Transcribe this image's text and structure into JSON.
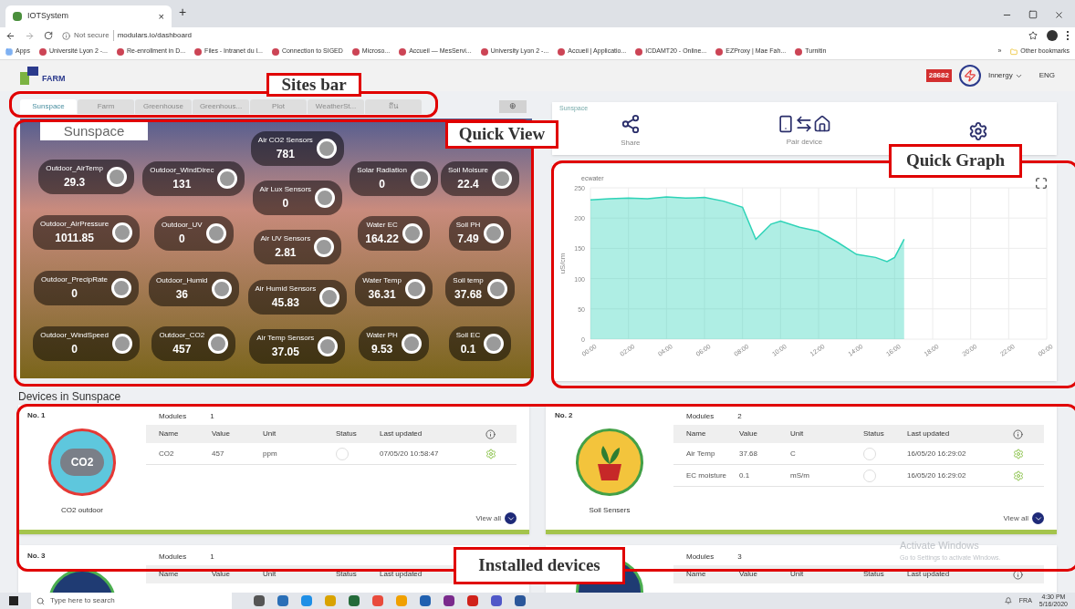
{
  "browser": {
    "tab_title": "IOTSystem",
    "tab_close": "×",
    "new_tab": "+",
    "security": "Not secure",
    "url": "modulars.io/dashboard",
    "bookmarks": [
      {
        "label": "Apps"
      },
      {
        "label": "Université Lyon 2 -..."
      },
      {
        "label": "Re-enrollment in D..."
      },
      {
        "label": "Files - Intranet du l..."
      },
      {
        "label": "Connection to SIGED"
      },
      {
        "label": "Microso..."
      },
      {
        "label": "Accueil — MesServi..."
      },
      {
        "label": "University Lyon 2 -..."
      },
      {
        "label": "Accueil | Applicatio..."
      },
      {
        "label": "ICDAMT20 - Online..."
      },
      {
        "label": "EZProxy | Mae Fah..."
      },
      {
        "label": "Turnitin"
      }
    ],
    "more": "»",
    "other_bookmarks": "Other bookmarks"
  },
  "header": {
    "logo_text": "FARM",
    "badge": "28682",
    "user": "Innergy",
    "language": "ENG"
  },
  "sites_tabs": [
    {
      "label": "Sunspace",
      "selected": true
    },
    {
      "label": "Farm",
      "selected": false
    },
    {
      "label": "Greenhouse",
      "selected": false
    },
    {
      "label": "Greenhous...",
      "selected": false
    },
    {
      "label": "Plot",
      "selected": false
    },
    {
      "label": "WeatherSt...",
      "selected": false
    },
    {
      "label": "ถึน",
      "selected": false
    }
  ],
  "add_site": "⊕",
  "quick_view": {
    "title": "Sunspace",
    "groups": [
      {
        "sensors": [
          {
            "label": "Outdoor_AirTemp",
            "value": "29.3"
          },
          {
            "label": "Outdoor_AirPressure",
            "value": "1011.85"
          },
          {
            "label": "Outdoor_PrecipRate",
            "value": "0"
          },
          {
            "label": "Outdoor_WindSpeed",
            "value": "0"
          }
        ]
      },
      {
        "sensors": [
          {
            "label": "Outdoor_WindDirec",
            "value": "131"
          },
          {
            "label": "Outdoor_UV",
            "value": "0"
          },
          {
            "label": "Outdoor_Humid",
            "value": "36"
          },
          {
            "label": "Outdoor_CO2",
            "value": "457"
          }
        ]
      },
      {
        "sensors": [
          {
            "label": "Air CO2 Sensors",
            "value": "781"
          },
          {
            "label": "Air Lux Sensors",
            "value": "0"
          },
          {
            "label": "Air UV Sensors",
            "value": "2.81"
          },
          {
            "label": "Air Humid Sensors",
            "value": "45.83"
          },
          {
            "label": "Air Temp Sensors",
            "value": "37.05"
          }
        ]
      },
      {
        "sensors": [
          {
            "label": "Solar Radiation",
            "value": "0"
          },
          {
            "label": "Water EC",
            "value": "164.22"
          },
          {
            "label": "Water Temp",
            "value": "36.31"
          },
          {
            "label": "Water PH",
            "value": "9.53"
          }
        ]
      },
      {
        "sensors": [
          {
            "label": "Soil Moisure",
            "value": "22.4"
          },
          {
            "label": "Soil PH",
            "value": "7.49"
          },
          {
            "label": "Soil temp",
            "value": "37.68"
          },
          {
            "label": "Soil EC",
            "value": "0.1"
          }
        ]
      }
    ]
  },
  "actions": {
    "site": "Sunspace",
    "items": [
      {
        "kind": "share",
        "label": "Share"
      },
      {
        "kind": "pair",
        "label": "Pair device"
      },
      {
        "kind": "settings"
      }
    ]
  },
  "quick_graph": {
    "chart_data": {
      "type": "area",
      "grid": true,
      "ylabel": "uS/cm",
      "x": [
        0,
        1,
        2,
        3,
        4,
        5,
        6,
        7,
        8,
        8.7,
        9.5,
        10,
        11,
        12,
        13,
        14,
        15,
        15.6,
        16,
        16.5
      ],
      "series": [
        {
          "name": "ecwater",
          "color": "#2ed3b7",
          "values": [
            230,
            232,
            233,
            232,
            235,
            233,
            234,
            228,
            218,
            165,
            190,
            195,
            185,
            178,
            160,
            140,
            135,
            128,
            135,
            165
          ]
        }
      ],
      "xlim": [
        0,
        24
      ],
      "ylim": [
        0,
        250
      ],
      "xticks": [
        {
          "value": 0,
          "label": "00:00"
        },
        {
          "value": 2,
          "label": "02:00"
        },
        {
          "value": 4,
          "label": "04:00"
        },
        {
          "value": 6,
          "label": "06:00"
        },
        {
          "value": 8,
          "label": "08:00"
        },
        {
          "value": 10,
          "label": "10:00"
        },
        {
          "value": 12,
          "label": "12:00"
        },
        {
          "value": 14,
          "label": "14:00"
        },
        {
          "value": 16,
          "label": "16:00"
        },
        {
          "value": 18,
          "label": "18:00"
        },
        {
          "value": 20,
          "label": "20:00"
        },
        {
          "value": 22,
          "label": "22:00"
        },
        {
          "value": 24,
          "label": "00:00"
        }
      ],
      "yticks": [
        0,
        50,
        100,
        150,
        200,
        250
      ]
    }
  },
  "devices": {
    "title": "Devices in Sunspace",
    "cards": [
      {
        "no": "No. 1",
        "name": "CO2 outdoor",
        "icon": {
          "kind": "co2",
          "text": "CO2",
          "color": "#e53935"
        },
        "modules_label": "Modules",
        "modules": "1",
        "columns": [
          "Name",
          "Value",
          "Unit",
          "Status",
          "Last updated"
        ],
        "rows": [
          {
            "name": "CO2",
            "value": "457",
            "unit": "ppm",
            "updated": "07/05/20 10:58:47"
          }
        ],
        "view_all": "View all"
      },
      {
        "no": "No. 2",
        "name": "Soil Sensers",
        "icon": {
          "kind": "plant",
          "color": "#43a047"
        },
        "modules_label": "Modules",
        "modules": "2",
        "columns": [
          "Name",
          "Value",
          "Unit",
          "Status",
          "Last updated"
        ],
        "rows": [
          {
            "name": "Air Temp",
            "value": "37.68",
            "unit": "C",
            "updated": "16/05/20 16:29:02"
          },
          {
            "name": "EC moisture",
            "value": "0.1",
            "unit": "mS/m",
            "updated": "16/05/20 16:29:02"
          }
        ],
        "view_all": "View all"
      },
      {
        "no": "No. 3",
        "icon": {
          "kind": "other",
          "color": "#4caf50"
        },
        "modules_label": "Modules",
        "modules": "1",
        "columns": [
          "Name",
          "Value",
          "Unit",
          "Status",
          "Last updated"
        ]
      },
      {
        "icon": {
          "kind": "other",
          "color": "#4caf50"
        },
        "modules_label": "Modules",
        "modules": "3",
        "columns": [
          "Name",
          "Value",
          "Unit",
          "Status",
          "Last updated"
        ]
      }
    ]
  },
  "os_notice": {
    "title": "Activate Windows",
    "text": "Go to Settings to activate Windows."
  },
  "taskbar": {
    "search_placeholder": "Type here to search",
    "language": "FRA",
    "time": "4:30 PM",
    "date": "5/16/2020"
  },
  "annotations": [
    {
      "text": "Sites bar"
    },
    {
      "text": "Quick View"
    },
    {
      "text": "Quick Graph"
    },
    {
      "text": "Installed devices"
    }
  ]
}
